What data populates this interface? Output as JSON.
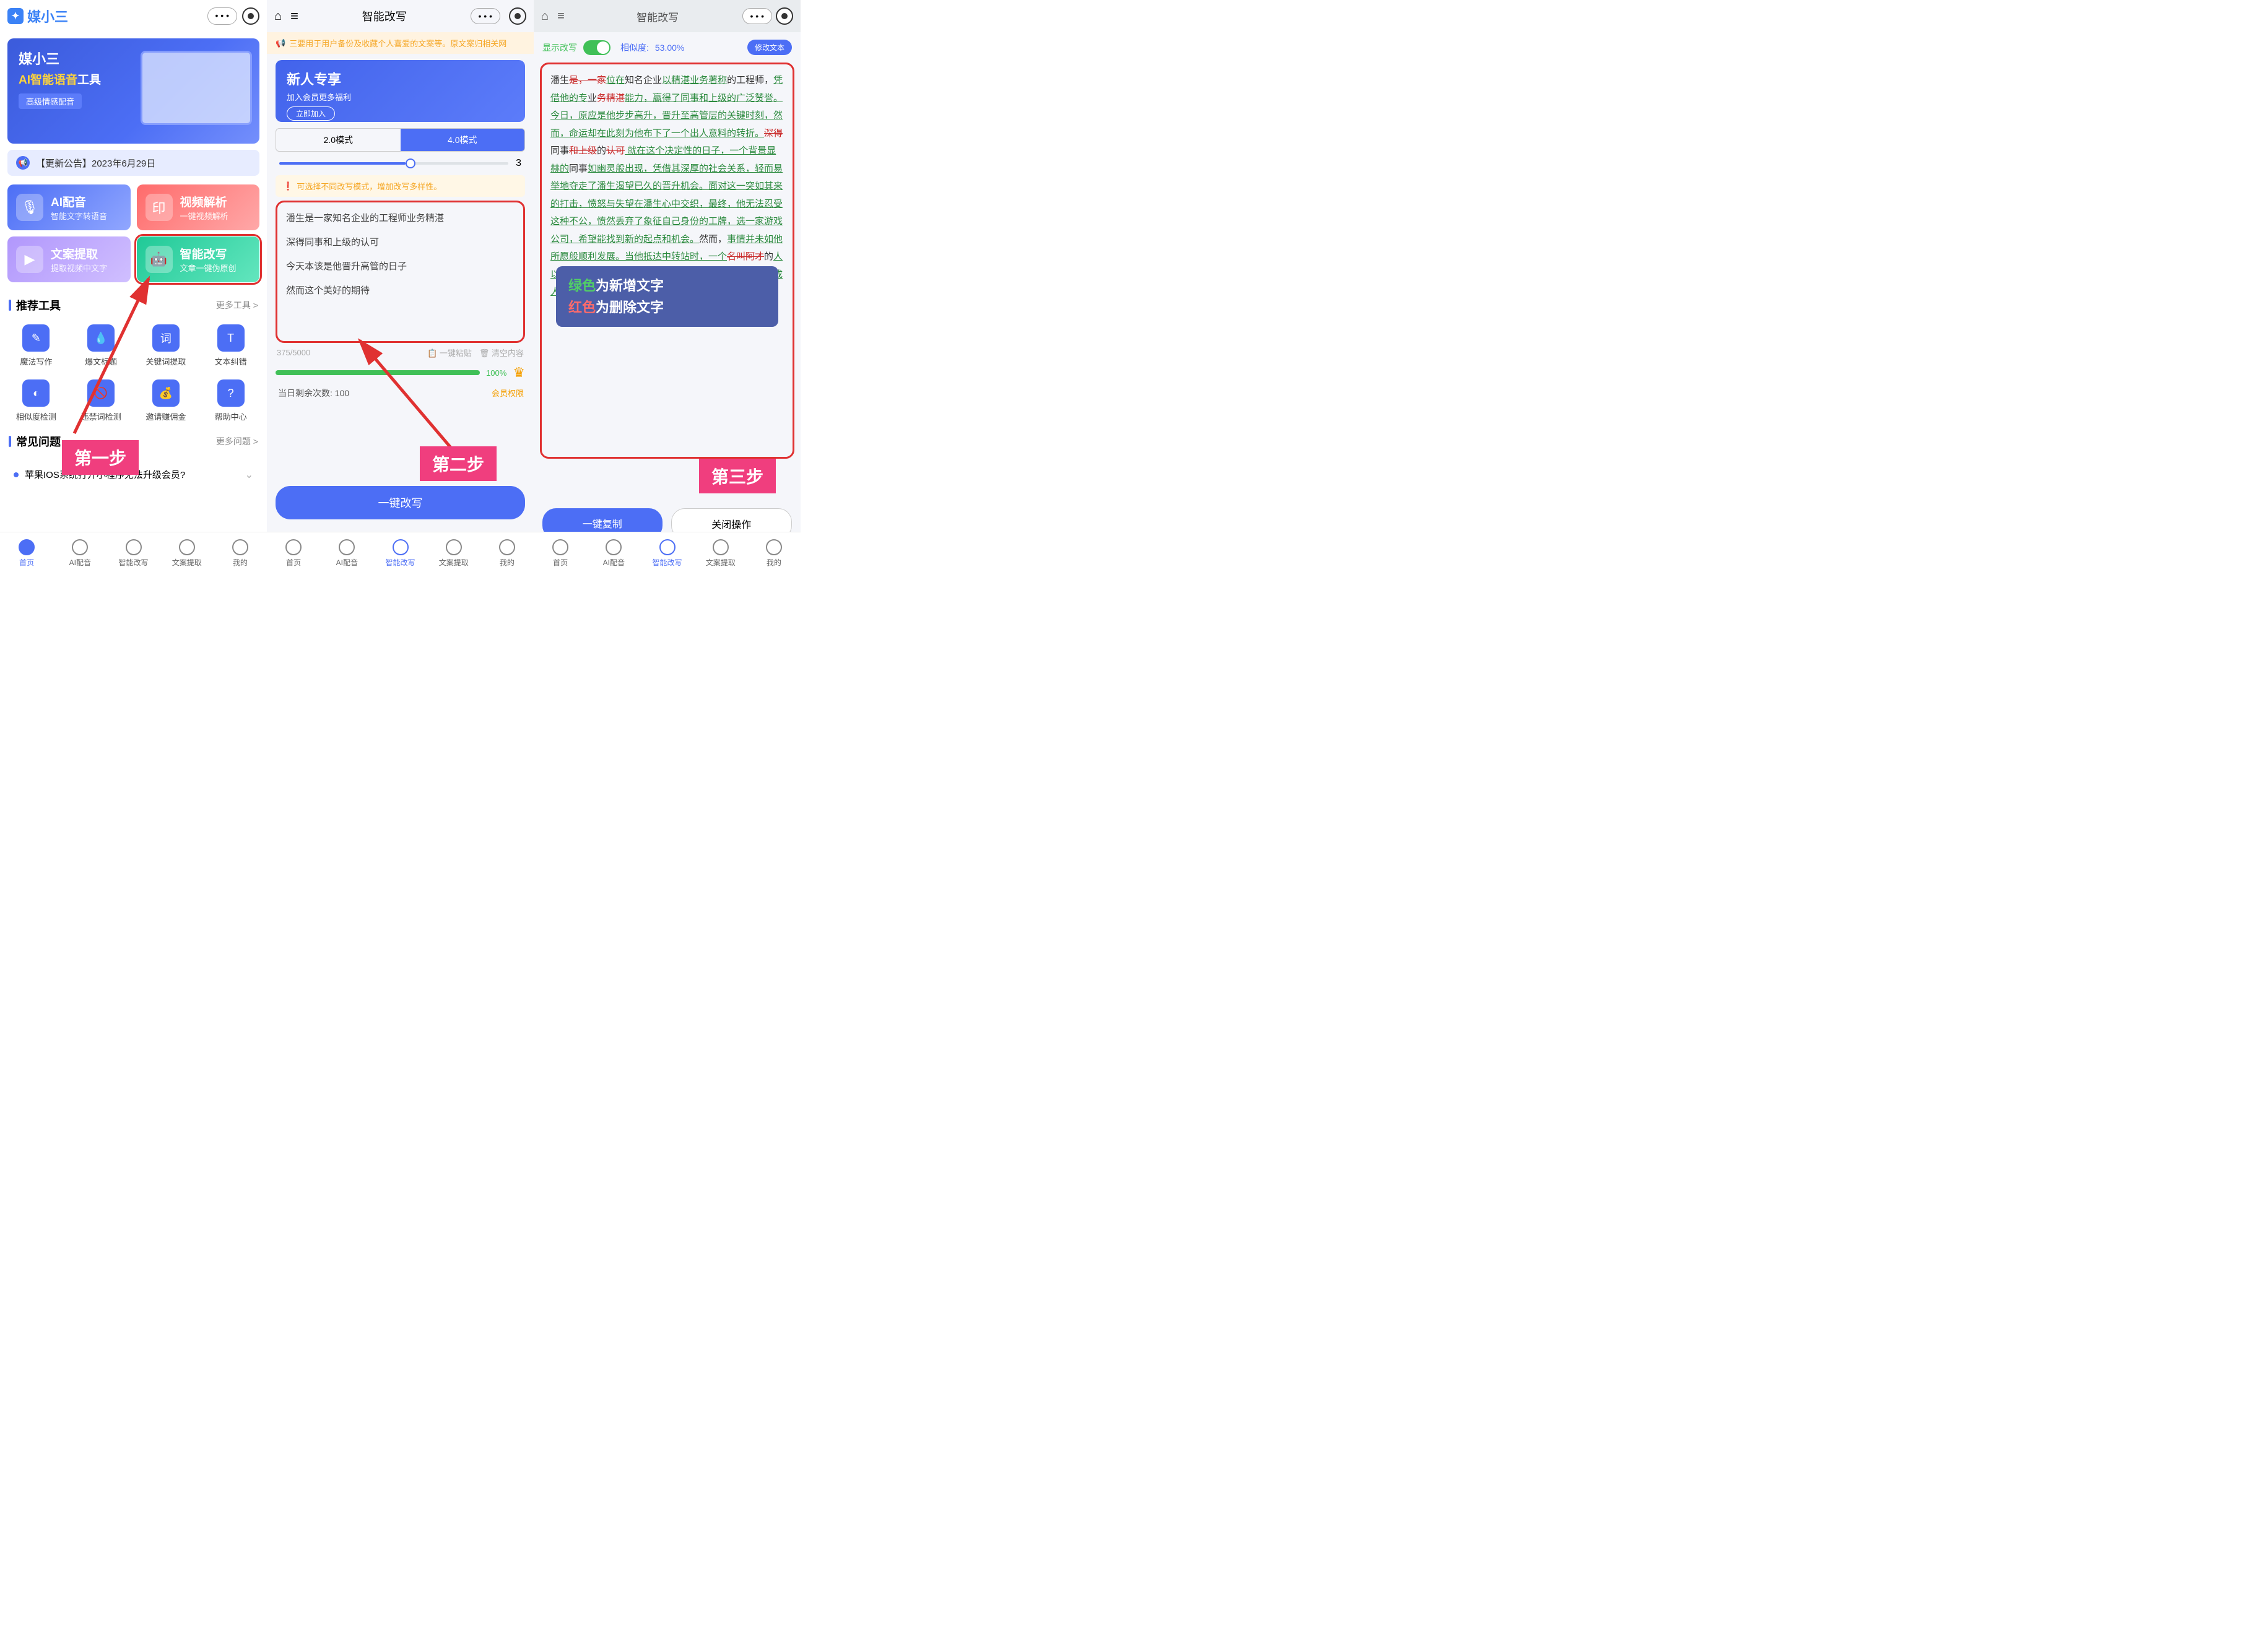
{
  "panel1": {
    "logo": "媒小三",
    "hero": {
      "t1": "媒小三",
      "t2a": "AI智能语音",
      "t2b": "工具",
      "tag": "高级情感配音"
    },
    "notice": "【更新公告】2023年6月29日",
    "cards": [
      {
        "t1": "AI配音",
        "t2": "智能文字转语音"
      },
      {
        "t1": "视频解析",
        "t2": "一键视频解析"
      },
      {
        "t1": "文案提取",
        "t2": "提取视频中文字"
      },
      {
        "t1": "智能改写",
        "t2": "文章一键伪原创"
      }
    ],
    "sections": {
      "tools": "推荐工具",
      "tools_more": "更多工具 >",
      "faq": "常见问题",
      "faq_more": "更多问题 >"
    },
    "tools": [
      "魔法写作",
      "爆文标题",
      "关键词提取",
      "文本纠错",
      "相似度检测",
      "违禁词检测",
      "邀请赚佣金",
      "帮助中心"
    ],
    "faq_q": "苹果IOS系统打开小程序无法升级会员?",
    "step": "第一步"
  },
  "panel2": {
    "title": "智能改写",
    "warning": "三要用于用户备份及收藏个人喜爱的文案等。原文案归相关网",
    "promo": {
      "t": "新人专享",
      "s": "加入会员更多福利",
      "b": "立即加入"
    },
    "tabs": {
      "a": "2.0模式",
      "b": "4.0模式"
    },
    "slider_val": "3",
    "tip": "可选择不同改写模式，增加改写多样性。",
    "lines": [
      "潘生是一家知名企业的工程师业务精湛",
      "深得同事和上级的认可",
      "今天本该是他晋升高管的日子",
      "然而这个美好的期待"
    ],
    "counter": "375/5000",
    "paste": "一键粘贴",
    "clear": "清空内容",
    "progress": "100%",
    "remain_lbl": "当日剩余次数:",
    "remain_val": "100",
    "vip": "会员权限",
    "btn": "一键改写",
    "step": "第二步"
  },
  "panel3": {
    "title": "智能改写",
    "show_rewrite": "显示改写",
    "sim_lbl": "相似度:",
    "sim_val": "53.00%",
    "edit": "修改文本",
    "legend": {
      "l1a": "绿色",
      "l1b": "为新增文字",
      "l2a": "红色",
      "l2b": "为删除文字"
    },
    "step": "第三步",
    "btn1": "一键复制",
    "btn2": "关闭操作",
    "diff_segments": [
      {
        "t": "潘生",
        "c": "norm"
      },
      {
        "t": "是，一家",
        "c": "del"
      },
      {
        "t": "位在",
        "c": "add"
      },
      {
        "t": "知名企业",
        "c": "norm"
      },
      {
        "t": "以精湛业务著称",
        "c": "add"
      },
      {
        "t": "的工程师，",
        "c": "norm"
      },
      {
        "t": "凭借他的专",
        "c": "add"
      },
      {
        "t": "业",
        "c": "norm"
      },
      {
        "t": "务精湛",
        "c": "del"
      },
      {
        "t": "能力，赢得了同事和上级的广泛赞誉。今日，原应是他步步高升，晋升至高管层的关键时刻，然而，命运却在此刻为他布下了一个出人意料的转折。",
        "c": "add"
      },
      {
        "t": "深得",
        "c": "del"
      },
      {
        "t": "同事",
        "c": "norm"
      },
      {
        "t": "和上级",
        "c": "del"
      },
      {
        "t": "的",
        "c": "norm"
      },
      {
        "t": "认可",
        "c": "del"
      },
      {
        "t": " 就在这个决定性的日子，一个背景显赫的",
        "c": "add"
      },
      {
        "t": "同事",
        "c": "norm"
      },
      {
        "t": "如幽灵般出现，凭借其深厚的",
        "c": "add"
      },
      {
        "t": "社会关系，轻而易举地夺走了潘生渴望已久的晋升机会。面对这一突如其来的打击，愤怒与失望在潘生心中交织，最终，他无法忍受这种不公，愤然丢弃了象征自己身份的工牌，选",
        "c": "add"
      },
      {
        "t": "一家游戏公司，希望能找到新的起点和机会。",
        "c": "add"
      },
      {
        "t": "然而，",
        "c": "norm"
      },
      {
        "t": "事情并未如他所愿般顺利发展。当他抵达中转站时，一个",
        "c": "add"
      },
      {
        "t": "名叫阿才",
        "c": "del"
      },
      {
        "t": "的",
        "c": "norm"
      },
      {
        "t": "人以转机为由，收走了他们的护照，并邀请大家一同观看成人秀。",
        "c": "add"
      },
      {
        "t": "却被一个突如其来的转折打破",
        "c": "del"
      },
      {
        "t": "\n\n",
        "c": "norm"
      },
      {
        "t": "一位拥有显赫家",
        "c": "del"
      }
    ]
  },
  "nav": [
    "首页",
    "AI配音",
    "智能改写",
    "文案提取",
    "我的"
  ]
}
